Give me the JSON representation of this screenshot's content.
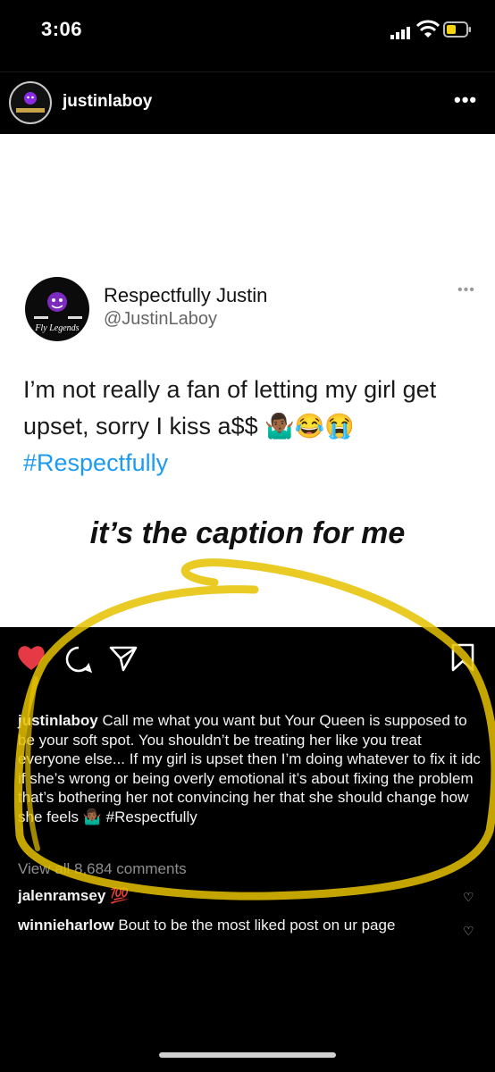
{
  "status_bar": {
    "time": "3:06"
  },
  "post": {
    "username": "justinlaboy",
    "more_icon": "more-horizontal-icon"
  },
  "tweet": {
    "display_name": "Respectfully Justin",
    "handle": "@JustinLaboy",
    "avatar_text": "Fly Legends",
    "line1": "I’m not really a fan of letting my girl get",
    "line2": "upset, sorry I kiss a$$ 🤷🏾‍♂️😂😭",
    "hashtag": "#Respectfully"
  },
  "overlay_caption": "it’s the caption for me",
  "caption": {
    "username": "justinlaboy",
    "text": "Call me what you want but Your Queen is supposed to be your soft spot. You shouldn’t be treating her like you treat everyone else... If my girl is upset then I’m doing whatever to fix it idc if she’s wrong or being overly emotional it’s about fixing the problem that’s bothering her not convincing her that she should change how she feels",
    "emoji_hashtag": "🤷🏾‍♂️ #Respectfully"
  },
  "view_all_comments": "View all 8,684 comments",
  "comments": [
    {
      "username": "jalenramsey",
      "text": "💯"
    },
    {
      "username": "winnieharlow",
      "text": "Bout to be the most liked post on ur page"
    }
  ],
  "colors": {
    "like": "#e63946",
    "hashtag": "#1d9bf0",
    "highlight": "#e6c200"
  }
}
